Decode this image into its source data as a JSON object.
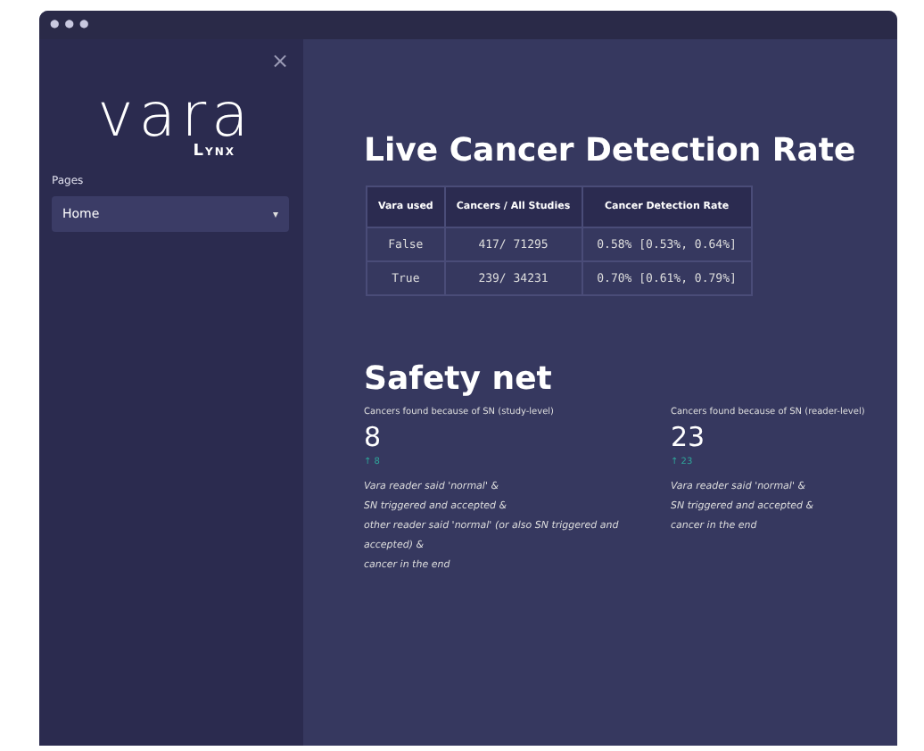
{
  "window": {
    "controls": [
      "●",
      "●",
      "●"
    ]
  },
  "sidebar": {
    "close": "×",
    "logo": {
      "word": "vara",
      "sub": "Lynx"
    },
    "pages_label": "Pages",
    "select": {
      "value": "Home",
      "caret": "▾"
    }
  },
  "main": {
    "title": "Live Cancer Detection Rate",
    "table": {
      "columns": [
        "Vara used",
        "Cancers / All Studies",
        "Cancer Detection Rate"
      ],
      "rows": [
        [
          "False",
          "417/ 71295",
          "0.58% [0.53%, 0.64%]"
        ],
        [
          "True",
          "239/ 34231",
          "0.70% [0.61%, 0.79%]"
        ]
      ]
    },
    "safety_title": "Safety net",
    "metrics": [
      {
        "label": "Cancers found because of SN (study-level)",
        "value": "8",
        "delta": "↑ 8",
        "notes": [
          "Vara reader said 'normal' &",
          "SN triggered and accepted &",
          "other reader said 'normal' (or also SN triggered and accepted) &",
          "cancer in the end"
        ]
      },
      {
        "label": "Cancers found because of SN (reader-level)",
        "value": "23",
        "delta": "↑ 23",
        "notes": [
          "Vara reader said 'normal' &",
          "SN triggered and accepted &",
          "cancer in the end"
        ]
      }
    ]
  }
}
